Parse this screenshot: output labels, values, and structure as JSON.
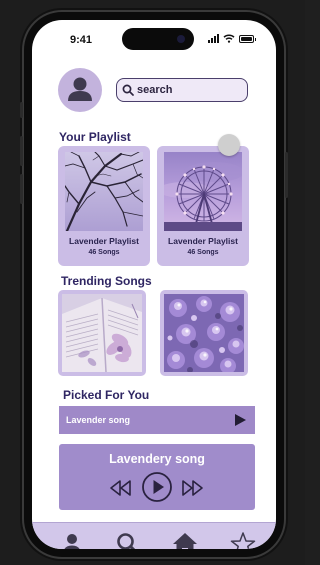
{
  "status_bar": {
    "time": "9:41"
  },
  "header": {
    "avatar_icon": "user-avatar-icon",
    "search": {
      "placeholder": "search",
      "value": ""
    }
  },
  "your_playlist": {
    "title": "Your Playlist",
    "items": [
      {
        "name": "Lavender Playlist",
        "count": "46 Songs",
        "image": "bare-tree-branches-lavender-sky"
      },
      {
        "name": "Lavender Playlist",
        "count": "46 Songs",
        "image": "ferris-wheel-purple-sky"
      }
    ]
  },
  "trending_songs": {
    "title": "Trending Songs",
    "items": [
      {
        "image": "open-book-with-pressed-flowers"
      },
      {
        "image": "purple-flowers-closeup"
      }
    ]
  },
  "picked_for_you": {
    "title": "Picked For You",
    "song": "Lavender song"
  },
  "player": {
    "title": "Lavendery song",
    "controls": [
      "rewind-icon",
      "play-icon",
      "fast-forward-icon"
    ]
  },
  "bottom_nav": [
    "user-icon",
    "search-icon",
    "home-icon",
    "star-icon"
  ],
  "colors": {
    "accent_light": "#cbbde6",
    "accent": "#a08ccb",
    "title_purple": "#2f2663",
    "nav_bg": "#d2c7ea"
  }
}
